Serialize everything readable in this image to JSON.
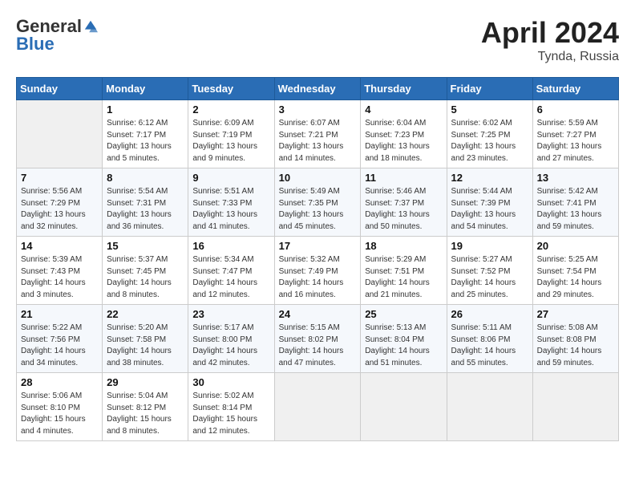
{
  "header": {
    "logo_general": "General",
    "logo_blue": "Blue",
    "month_title": "April 2024",
    "location": "Tynda, Russia"
  },
  "days_of_week": [
    "Sunday",
    "Monday",
    "Tuesday",
    "Wednesday",
    "Thursday",
    "Friday",
    "Saturday"
  ],
  "weeks": [
    [
      {
        "day": "",
        "info": ""
      },
      {
        "day": "1",
        "info": "Sunrise: 6:12 AM\nSunset: 7:17 PM\nDaylight: 13 hours\nand 5 minutes."
      },
      {
        "day": "2",
        "info": "Sunrise: 6:09 AM\nSunset: 7:19 PM\nDaylight: 13 hours\nand 9 minutes."
      },
      {
        "day": "3",
        "info": "Sunrise: 6:07 AM\nSunset: 7:21 PM\nDaylight: 13 hours\nand 14 minutes."
      },
      {
        "day": "4",
        "info": "Sunrise: 6:04 AM\nSunset: 7:23 PM\nDaylight: 13 hours\nand 18 minutes."
      },
      {
        "day": "5",
        "info": "Sunrise: 6:02 AM\nSunset: 7:25 PM\nDaylight: 13 hours\nand 23 minutes."
      },
      {
        "day": "6",
        "info": "Sunrise: 5:59 AM\nSunset: 7:27 PM\nDaylight: 13 hours\nand 27 minutes."
      }
    ],
    [
      {
        "day": "7",
        "info": "Sunrise: 5:56 AM\nSunset: 7:29 PM\nDaylight: 13 hours\nand 32 minutes."
      },
      {
        "day": "8",
        "info": "Sunrise: 5:54 AM\nSunset: 7:31 PM\nDaylight: 13 hours\nand 36 minutes."
      },
      {
        "day": "9",
        "info": "Sunrise: 5:51 AM\nSunset: 7:33 PM\nDaylight: 13 hours\nand 41 minutes."
      },
      {
        "day": "10",
        "info": "Sunrise: 5:49 AM\nSunset: 7:35 PM\nDaylight: 13 hours\nand 45 minutes."
      },
      {
        "day": "11",
        "info": "Sunrise: 5:46 AM\nSunset: 7:37 PM\nDaylight: 13 hours\nand 50 minutes."
      },
      {
        "day": "12",
        "info": "Sunrise: 5:44 AM\nSunset: 7:39 PM\nDaylight: 13 hours\nand 54 minutes."
      },
      {
        "day": "13",
        "info": "Sunrise: 5:42 AM\nSunset: 7:41 PM\nDaylight: 13 hours\nand 59 minutes."
      }
    ],
    [
      {
        "day": "14",
        "info": "Sunrise: 5:39 AM\nSunset: 7:43 PM\nDaylight: 14 hours\nand 3 minutes."
      },
      {
        "day": "15",
        "info": "Sunrise: 5:37 AM\nSunset: 7:45 PM\nDaylight: 14 hours\nand 8 minutes."
      },
      {
        "day": "16",
        "info": "Sunrise: 5:34 AM\nSunset: 7:47 PM\nDaylight: 14 hours\nand 12 minutes."
      },
      {
        "day": "17",
        "info": "Sunrise: 5:32 AM\nSunset: 7:49 PM\nDaylight: 14 hours\nand 16 minutes."
      },
      {
        "day": "18",
        "info": "Sunrise: 5:29 AM\nSunset: 7:51 PM\nDaylight: 14 hours\nand 21 minutes."
      },
      {
        "day": "19",
        "info": "Sunrise: 5:27 AM\nSunset: 7:52 PM\nDaylight: 14 hours\nand 25 minutes."
      },
      {
        "day": "20",
        "info": "Sunrise: 5:25 AM\nSunset: 7:54 PM\nDaylight: 14 hours\nand 29 minutes."
      }
    ],
    [
      {
        "day": "21",
        "info": "Sunrise: 5:22 AM\nSunset: 7:56 PM\nDaylight: 14 hours\nand 34 minutes."
      },
      {
        "day": "22",
        "info": "Sunrise: 5:20 AM\nSunset: 7:58 PM\nDaylight: 14 hours\nand 38 minutes."
      },
      {
        "day": "23",
        "info": "Sunrise: 5:17 AM\nSunset: 8:00 PM\nDaylight: 14 hours\nand 42 minutes."
      },
      {
        "day": "24",
        "info": "Sunrise: 5:15 AM\nSunset: 8:02 PM\nDaylight: 14 hours\nand 47 minutes."
      },
      {
        "day": "25",
        "info": "Sunrise: 5:13 AM\nSunset: 8:04 PM\nDaylight: 14 hours\nand 51 minutes."
      },
      {
        "day": "26",
        "info": "Sunrise: 5:11 AM\nSunset: 8:06 PM\nDaylight: 14 hours\nand 55 minutes."
      },
      {
        "day": "27",
        "info": "Sunrise: 5:08 AM\nSunset: 8:08 PM\nDaylight: 14 hours\nand 59 minutes."
      }
    ],
    [
      {
        "day": "28",
        "info": "Sunrise: 5:06 AM\nSunset: 8:10 PM\nDaylight: 15 hours\nand 4 minutes."
      },
      {
        "day": "29",
        "info": "Sunrise: 5:04 AM\nSunset: 8:12 PM\nDaylight: 15 hours\nand 8 minutes."
      },
      {
        "day": "30",
        "info": "Sunrise: 5:02 AM\nSunset: 8:14 PM\nDaylight: 15 hours\nand 12 minutes."
      },
      {
        "day": "",
        "info": ""
      },
      {
        "day": "",
        "info": ""
      },
      {
        "day": "",
        "info": ""
      },
      {
        "day": "",
        "info": ""
      }
    ]
  ]
}
